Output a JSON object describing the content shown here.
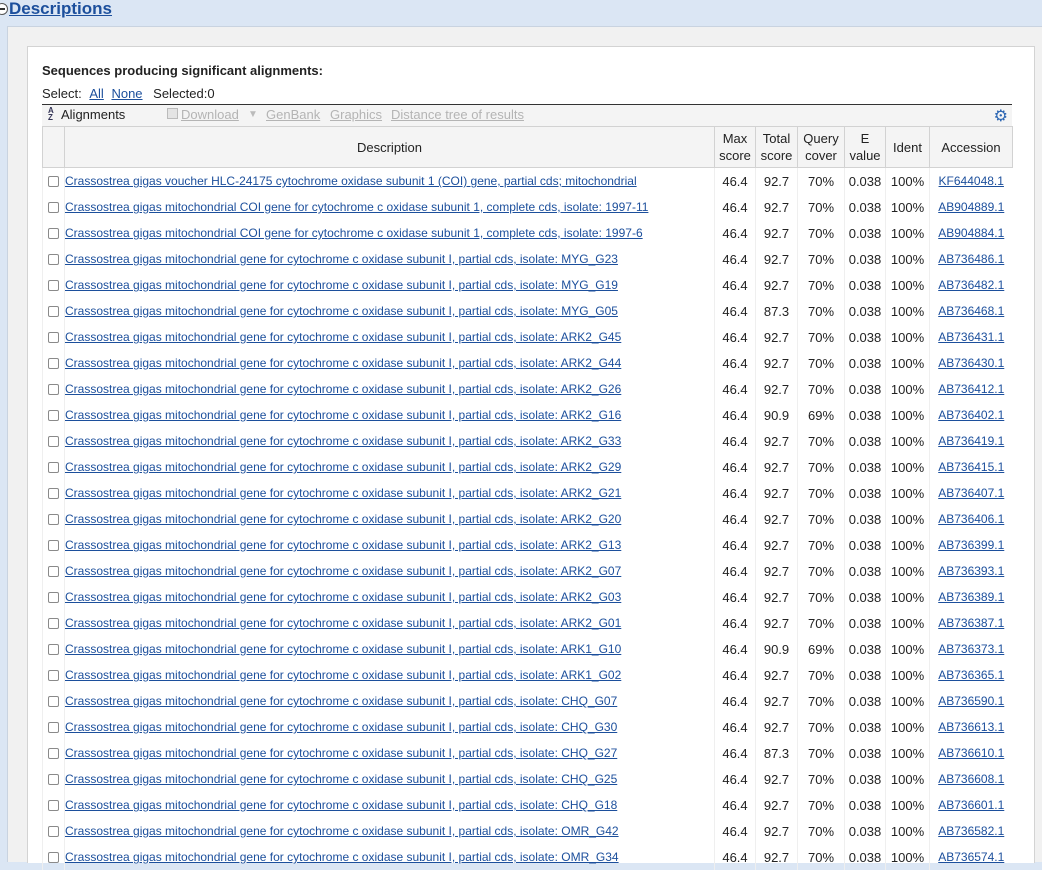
{
  "section": {
    "title": "Descriptions"
  },
  "heading": "Sequences producing significant alignments:",
  "select": {
    "label": "Select:",
    "all": "All",
    "none": "None",
    "selected": "Selected:0"
  },
  "toolbar": {
    "alignments": "Alignments",
    "download": "Download",
    "genbank": "GenBank",
    "graphics": "Graphics",
    "tree": "Distance tree of results",
    "gear_icon": "gear-icon",
    "sort_icon": "sort-az-icon"
  },
  "columns": {
    "description": "Description",
    "max_score": [
      "Max",
      "score"
    ],
    "total_score": [
      "Total",
      "score"
    ],
    "query_cover": [
      "Query",
      "cover"
    ],
    "evalue": [
      "E",
      "value"
    ],
    "ident": "Ident",
    "accession": "Accession"
  },
  "colors": {
    "link": "#1c4f9c",
    "page_bg": "#dbe6f4",
    "gear": "#2c66b3"
  },
  "rows": [
    {
      "desc": "Crassostrea gigas voucher HLC-24175 cytochrome oxidase subunit 1 (COI) gene, partial cds; mitochondrial",
      "max": "46.4",
      "total": "92.7",
      "cover": "70%",
      "e": "0.038",
      "ident": "100%",
      "acc": "KF644048.1"
    },
    {
      "desc": "Crassostrea gigas mitochondrial COI gene for cytochrome c oxidase subunit 1, complete cds, isolate: 1997-11",
      "max": "46.4",
      "total": "92.7",
      "cover": "70%",
      "e": "0.038",
      "ident": "100%",
      "acc": "AB904889.1"
    },
    {
      "desc": "Crassostrea gigas mitochondrial COI gene for cytochrome c oxidase subunit 1, complete cds, isolate: 1997-6",
      "max": "46.4",
      "total": "92.7",
      "cover": "70%",
      "e": "0.038",
      "ident": "100%",
      "acc": "AB904884.1"
    },
    {
      "desc": "Crassostrea gigas mitochondrial gene for cytochrome c oxidase subunit I, partial cds, isolate: MYG_G23",
      "max": "46.4",
      "total": "92.7",
      "cover": "70%",
      "e": "0.038",
      "ident": "100%",
      "acc": "AB736486.1"
    },
    {
      "desc": "Crassostrea gigas mitochondrial gene for cytochrome c oxidase subunit I, partial cds, isolate: MYG_G19",
      "max": "46.4",
      "total": "92.7",
      "cover": "70%",
      "e": "0.038",
      "ident": "100%",
      "acc": "AB736482.1"
    },
    {
      "desc": "Crassostrea gigas mitochondrial gene for cytochrome c oxidase subunit I, partial cds, isolate: MYG_G05",
      "max": "46.4",
      "total": "87.3",
      "cover": "70%",
      "e": "0.038",
      "ident": "100%",
      "acc": "AB736468.1"
    },
    {
      "desc": "Crassostrea gigas mitochondrial gene for cytochrome c oxidase subunit I, partial cds, isolate: ARK2_G45",
      "max": "46.4",
      "total": "92.7",
      "cover": "70%",
      "e": "0.038",
      "ident": "100%",
      "acc": "AB736431.1"
    },
    {
      "desc": "Crassostrea gigas mitochondrial gene for cytochrome c oxidase subunit I, partial cds, isolate: ARK2_G44",
      "max": "46.4",
      "total": "92.7",
      "cover": "70%",
      "e": "0.038",
      "ident": "100%",
      "acc": "AB736430.1"
    },
    {
      "desc": "Crassostrea gigas mitochondrial gene for cytochrome c oxidase subunit I, partial cds, isolate: ARK2_G26",
      "max": "46.4",
      "total": "92.7",
      "cover": "70%",
      "e": "0.038",
      "ident": "100%",
      "acc": "AB736412.1"
    },
    {
      "desc": "Crassostrea gigas mitochondrial gene for cytochrome c oxidase subunit I, partial cds, isolate: ARK2_G16",
      "max": "46.4",
      "total": "90.9",
      "cover": "69%",
      "e": "0.038",
      "ident": "100%",
      "acc": "AB736402.1"
    },
    {
      "desc": "Crassostrea gigas mitochondrial gene for cytochrome c oxidase subunit I, partial cds, isolate: ARK2_G33",
      "max": "46.4",
      "total": "92.7",
      "cover": "70%",
      "e": "0.038",
      "ident": "100%",
      "acc": "AB736419.1"
    },
    {
      "desc": "Crassostrea gigas mitochondrial gene for cytochrome c oxidase subunit I, partial cds, isolate: ARK2_G29",
      "max": "46.4",
      "total": "92.7",
      "cover": "70%",
      "e": "0.038",
      "ident": "100%",
      "acc": "AB736415.1"
    },
    {
      "desc": "Crassostrea gigas mitochondrial gene for cytochrome c oxidase subunit I, partial cds, isolate: ARK2_G21",
      "max": "46.4",
      "total": "92.7",
      "cover": "70%",
      "e": "0.038",
      "ident": "100%",
      "acc": "AB736407.1"
    },
    {
      "desc": "Crassostrea gigas mitochondrial gene for cytochrome c oxidase subunit I, partial cds, isolate: ARK2_G20",
      "max": "46.4",
      "total": "92.7",
      "cover": "70%",
      "e": "0.038",
      "ident": "100%",
      "acc": "AB736406.1"
    },
    {
      "desc": "Crassostrea gigas mitochondrial gene for cytochrome c oxidase subunit I, partial cds, isolate: ARK2_G13",
      "max": "46.4",
      "total": "92.7",
      "cover": "70%",
      "e": "0.038",
      "ident": "100%",
      "acc": "AB736399.1"
    },
    {
      "desc": "Crassostrea gigas mitochondrial gene for cytochrome c oxidase subunit I, partial cds, isolate: ARK2_G07",
      "max": "46.4",
      "total": "92.7",
      "cover": "70%",
      "e": "0.038",
      "ident": "100%",
      "acc": "AB736393.1"
    },
    {
      "desc": "Crassostrea gigas mitochondrial gene for cytochrome c oxidase subunit I, partial cds, isolate: ARK2_G03",
      "max": "46.4",
      "total": "92.7",
      "cover": "70%",
      "e": "0.038",
      "ident": "100%",
      "acc": "AB736389.1"
    },
    {
      "desc": "Crassostrea gigas mitochondrial gene for cytochrome c oxidase subunit I, partial cds, isolate: ARK2_G01",
      "max": "46.4",
      "total": "92.7",
      "cover": "70%",
      "e": "0.038",
      "ident": "100%",
      "acc": "AB736387.1"
    },
    {
      "desc": "Crassostrea gigas mitochondrial gene for cytochrome c oxidase subunit I, partial cds, isolate: ARK1_G10",
      "max": "46.4",
      "total": "90.9",
      "cover": "69%",
      "e": "0.038",
      "ident": "100%",
      "acc": "AB736373.1"
    },
    {
      "desc": "Crassostrea gigas mitochondrial gene for cytochrome c oxidase subunit I, partial cds, isolate: ARK1_G02",
      "max": "46.4",
      "total": "92.7",
      "cover": "70%",
      "e": "0.038",
      "ident": "100%",
      "acc": "AB736365.1"
    },
    {
      "desc": "Crassostrea gigas mitochondrial gene for cytochrome c oxidase subunit I, partial cds, isolate: CHQ_G07",
      "max": "46.4",
      "total": "92.7",
      "cover": "70%",
      "e": "0.038",
      "ident": "100%",
      "acc": "AB736590.1"
    },
    {
      "desc": "Crassostrea gigas mitochondrial gene for cytochrome c oxidase subunit I, partial cds, isolate: CHQ_G30",
      "max": "46.4",
      "total": "92.7",
      "cover": "70%",
      "e": "0.038",
      "ident": "100%",
      "acc": "AB736613.1"
    },
    {
      "desc": "Crassostrea gigas mitochondrial gene for cytochrome c oxidase subunit I, partial cds, isolate: CHQ_G27",
      "max": "46.4",
      "total": "87.3",
      "cover": "70%",
      "e": "0.038",
      "ident": "100%",
      "acc": "AB736610.1"
    },
    {
      "desc": "Crassostrea gigas mitochondrial gene for cytochrome c oxidase subunit I, partial cds, isolate: CHQ_G25",
      "max": "46.4",
      "total": "92.7",
      "cover": "70%",
      "e": "0.038",
      "ident": "100%",
      "acc": "AB736608.1"
    },
    {
      "desc": "Crassostrea gigas mitochondrial gene for cytochrome c oxidase subunit I, partial cds, isolate: CHQ_G18",
      "max": "46.4",
      "total": "92.7",
      "cover": "70%",
      "e": "0.038",
      "ident": "100%",
      "acc": "AB736601.1"
    },
    {
      "desc": "Crassostrea gigas mitochondrial gene for cytochrome c oxidase subunit I, partial cds, isolate: OMR_G42",
      "max": "46.4",
      "total": "92.7",
      "cover": "70%",
      "e": "0.038",
      "ident": "100%",
      "acc": "AB736582.1"
    },
    {
      "desc": "Crassostrea gigas mitochondrial gene for cytochrome c oxidase subunit I, partial cds, isolate: OMR_G34",
      "max": "46.4",
      "total": "92.7",
      "cover": "70%",
      "e": "0.038",
      "ident": "100%",
      "acc": "AB736574.1"
    }
  ]
}
